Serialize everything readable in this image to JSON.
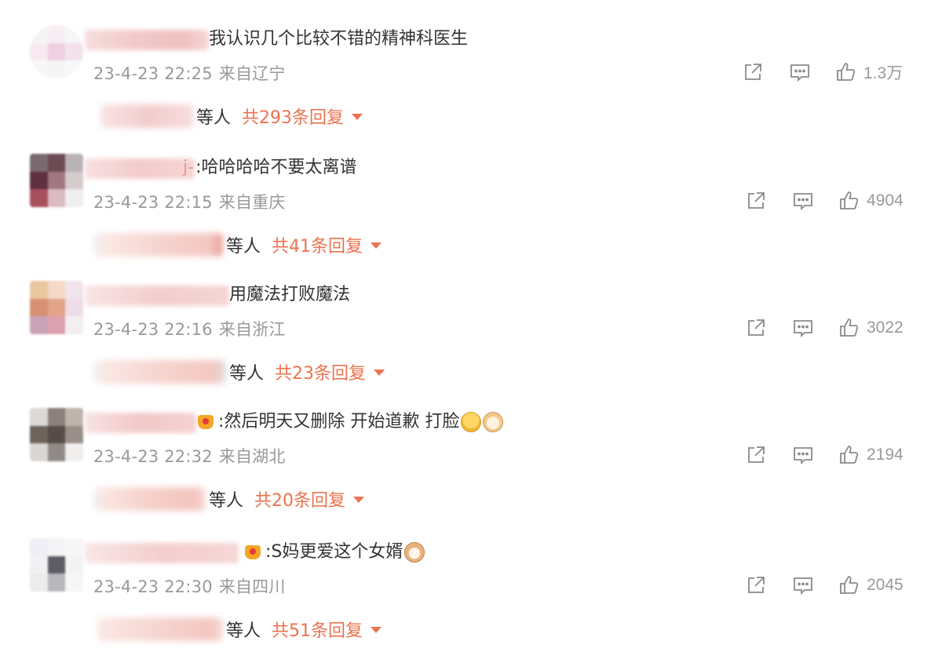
{
  "colors": {
    "accent": "#eb7350",
    "meta": "#999999",
    "text": "#333333"
  },
  "icons": {
    "share": "share-icon",
    "comment": "comment-icon",
    "like": "thumbs-up-icon",
    "caret": "caret-down-icon"
  },
  "reply_suffix": "等人",
  "comments": [
    {
      "content": "我认识几个比较不错的精神科医生",
      "date": "23-4-23 22:25",
      "location": "来自辽宁",
      "likes": "1.3万",
      "reply_count": "共293条回复"
    },
    {
      "content": ":哈哈哈哈不要太离谱",
      "date": "23-4-23 22:15",
      "location": "来自重庆",
      "likes": "4904",
      "reply_count": "共41条回复"
    },
    {
      "content": "用魔法打败魔法",
      "date": "23-4-23 22:16",
      "location": "来自浙江",
      "likes": "3022",
      "reply_count": "共23条回复"
    },
    {
      "content": ":然后明天又删除 开始道歉 打脸",
      "date": "23-4-23 22:32",
      "location": "来自湖北",
      "likes": "2194",
      "reply_count": "共20条回复"
    },
    {
      "content": ":S妈更爱这个女婿",
      "date": "23-4-23 22:30",
      "location": "来自四川",
      "likes": "2045",
      "reply_count": "共51条回复"
    }
  ]
}
